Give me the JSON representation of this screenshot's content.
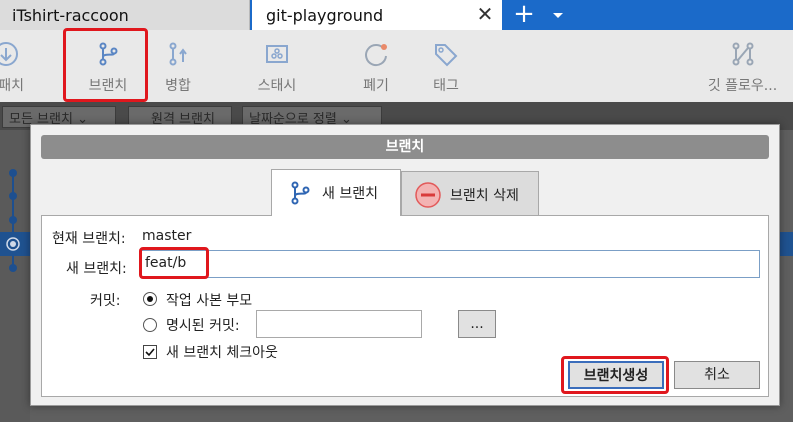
{
  "tabs": [
    {
      "label": "iTshirt-raccoon"
    },
    {
      "label": "git-playground"
    }
  ],
  "tab_close_glyph": "✕",
  "tab_add_glyph": "+",
  "toolbar": {
    "items": [
      {
        "label": "패치",
        "icon": "fetch-icon"
      },
      {
        "label": "브랜치",
        "icon": "branch-icon"
      },
      {
        "label": "병합",
        "icon": "merge-icon"
      },
      {
        "label": "스태시",
        "icon": "stash-icon"
      },
      {
        "label": "폐기",
        "icon": "discard-icon"
      },
      {
        "label": "태그",
        "icon": "tag-icon"
      },
      {
        "label": "깃 플로우...",
        "icon": "git-flow-icon"
      }
    ]
  },
  "filters": {
    "branches": "모든 브랜치 ⌄",
    "remote": "원격 브랜치",
    "sort": "날짜순으로 정렬 ⌄"
  },
  "dialog": {
    "title": "브랜치",
    "tab_new": "새 브랜치",
    "tab_delete": "브랜치 삭제",
    "current_branch_label": "현재 브랜치:",
    "current_branch_value": "master",
    "new_branch_label": "새 브랜치:",
    "new_branch_value": "feat/b",
    "commit_label": "커밋:",
    "option_parent": "작업 사본 부모",
    "option_specified": "명시된 커밋:",
    "browse_label": "...",
    "checkout_label": "새 브랜치 체크아웃",
    "create_button": "브랜치생성",
    "cancel_button": "취소"
  },
  "colors": {
    "accent": "#1b6ac9",
    "highlight": "#e0171d",
    "delete_icon": "#e25a5a"
  }
}
